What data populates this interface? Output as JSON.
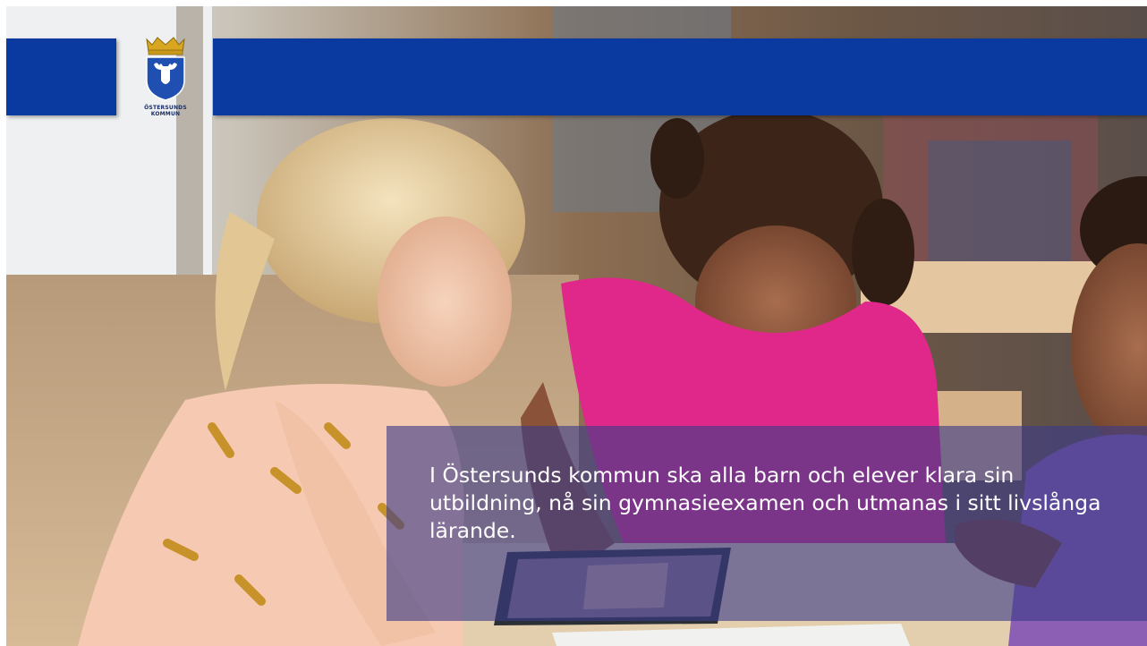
{
  "logo": {
    "line1": "ÖSTERSUNDS",
    "line2": "KOMMUN",
    "icon": "moose-crest-icon"
  },
  "caption": {
    "text": "I Östersunds kommun ska alla barn och elever klara sin\nutbildning, nå sin gymnasieexamen och utmanas i sitt livslånga\nlärande."
  },
  "colors": {
    "header_bar": "#0a3aa0",
    "caption_overlay": "#3c3c87",
    "caption_text": "#ffffff"
  }
}
